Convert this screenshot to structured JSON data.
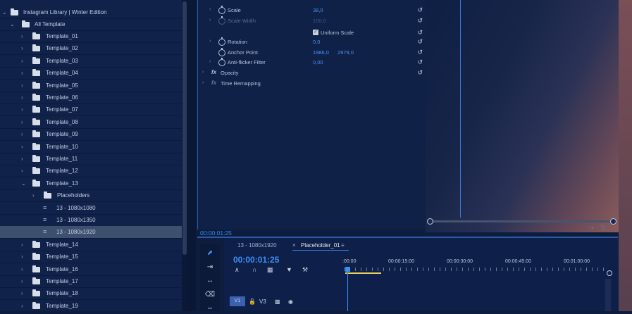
{
  "project": {
    "root_label": "Instagram Library | Winter Edition",
    "all_label": "All Template",
    "rows": [
      {
        "label": "Template_01",
        "kind": "folder",
        "depth": 2
      },
      {
        "label": "Template_02",
        "kind": "folder",
        "depth": 2
      },
      {
        "label": "Template_03",
        "kind": "folder",
        "depth": 2
      },
      {
        "label": "Template_04",
        "kind": "folder",
        "depth": 2
      },
      {
        "label": "Template_05",
        "kind": "folder",
        "depth": 2
      },
      {
        "label": "Template_06",
        "kind": "folder",
        "depth": 2
      },
      {
        "label": "Template_07",
        "kind": "folder",
        "depth": 2
      },
      {
        "label": "Template_08",
        "kind": "folder",
        "depth": 2
      },
      {
        "label": "Template_09",
        "kind": "folder",
        "depth": 2
      },
      {
        "label": "Template_10",
        "kind": "folder",
        "depth": 2
      },
      {
        "label": "Template_11",
        "kind": "folder",
        "depth": 2
      },
      {
        "label": "Template_12",
        "kind": "folder",
        "depth": 2
      },
      {
        "label": "Template_13",
        "kind": "folder",
        "depth": 2,
        "expanded": true
      },
      {
        "label": "Placeholders",
        "kind": "folder",
        "depth": 3
      },
      {
        "label": "13 - 1080x1080",
        "kind": "sequence",
        "depth": 3
      },
      {
        "label": "13 - 1080x1350",
        "kind": "sequence",
        "depth": 3
      },
      {
        "label": "13 - 1080x1920",
        "kind": "sequence",
        "depth": 3,
        "selected": true
      },
      {
        "label": "Template_14",
        "kind": "folder",
        "depth": 2
      },
      {
        "label": "Template_15",
        "kind": "folder",
        "depth": 2
      },
      {
        "label": "Template_16",
        "kind": "folder",
        "depth": 2
      },
      {
        "label": "Template_17",
        "kind": "folder",
        "depth": 2
      },
      {
        "label": "Template_18",
        "kind": "folder",
        "depth": 2
      },
      {
        "label": "Template_19",
        "kind": "folder",
        "depth": 2
      }
    ]
  },
  "effects": {
    "scale_label": "Scale",
    "scale_value": "38,0",
    "scale_width_label": "Scale Width",
    "scale_width_value": "100,0",
    "uniform_scale_label": "Uniform Scale",
    "rotation_label": "Rotation",
    "rotation_value": "0,0",
    "anchor_label": "Anchor Point",
    "anchor_x": "1986,0",
    "anchor_y": "2979,0",
    "antiflicker_label": "Anti-flicker Filter",
    "antiflicker_value": "0,00",
    "opacity_label": "Opacity",
    "time_remap_label": "Time Remapping",
    "timecode": "00:00:01:25"
  },
  "timeline": {
    "tab_inactive": "13 - 1080x1920",
    "tab_active": "Placeholder_01",
    "timecode": "00:00:01:25",
    "ruler": [
      ":00:00",
      "00:00:15:00",
      "00:00:30:00",
      "00:00:45:00",
      "00:01:00:00"
    ],
    "track_v1": "V1",
    "track_v3": "V3"
  },
  "colors": {
    "accent": "#3d8ff5",
    "panel_bg": "#0f2147",
    "selection": "#3d506e"
  }
}
